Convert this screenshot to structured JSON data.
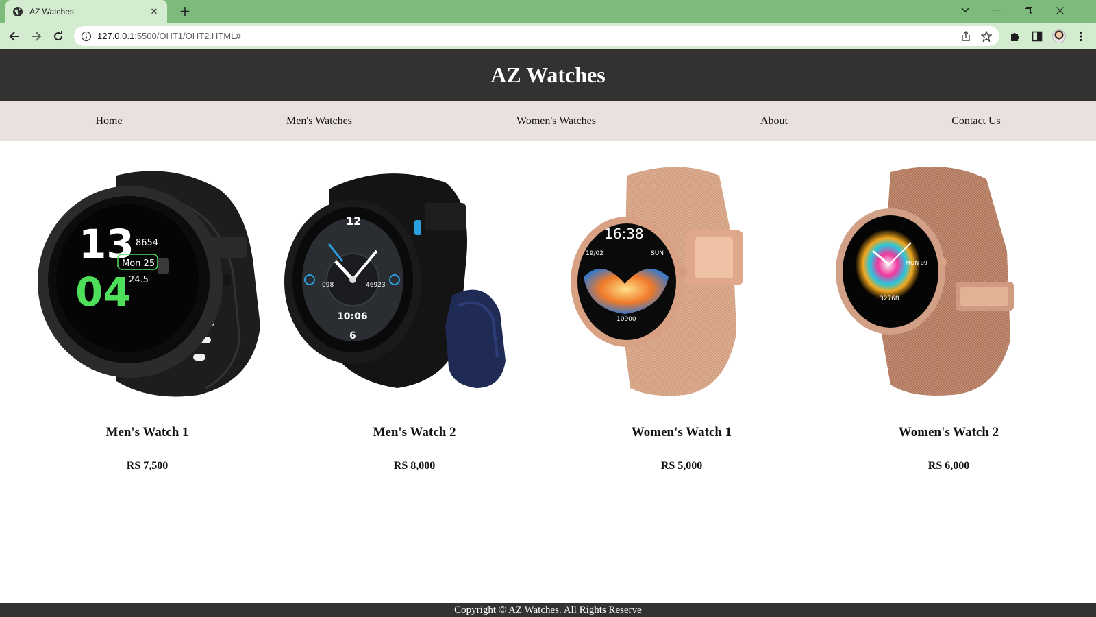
{
  "browser": {
    "tab_title": "AZ Watches",
    "new_tab_label": "+",
    "url_host": "127.0.0.1",
    "url_rest": ":5500/OHT1/OHT2.HTML#"
  },
  "site": {
    "title": "AZ Watches"
  },
  "nav": {
    "items": [
      {
        "label": "Home"
      },
      {
        "label": "Men's Watches"
      },
      {
        "label": "Women's Watches"
      },
      {
        "label": "About"
      },
      {
        "label": "Contact Us"
      }
    ]
  },
  "products": [
    {
      "name": "Men's Watch 1",
      "price": "RS 7,500",
      "dial_text_top": "13",
      "dial_text_bottom": "04",
      "dial_info_1": "8654",
      "dial_info_2": "Mon 25",
      "dial_info_3": "24.5"
    },
    {
      "name": "Men's Watch 2",
      "price": "RS 8,000",
      "dial_text_top": "12",
      "dial_time": "10:06",
      "dial_num_bottom": "6",
      "dial_left": "098",
      "dial_right": "46923"
    },
    {
      "name": "Women's Watch 1",
      "price": "RS 5,000",
      "dial_time": "16:38",
      "dial_date": "19/02",
      "dial_day": "SUN",
      "dial_steps": "10900"
    },
    {
      "name": "Women's Watch 2",
      "price": "RS 6,000",
      "dial_date": "MON 09",
      "dial_steps": "32768"
    }
  ],
  "footer": {
    "text": "Copyright © AZ Watches. All Rights Reserve"
  },
  "colors": {
    "tabbar": "#7cbb7c",
    "toolbar": "#d3ecd0",
    "header": "#343231",
    "nav": "#e8e1df"
  }
}
